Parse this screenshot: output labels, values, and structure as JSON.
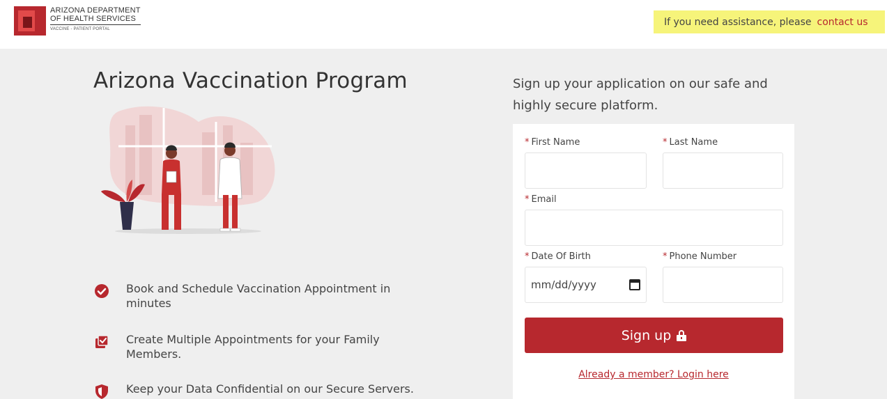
{
  "header": {
    "logo": {
      "line1": "ARIZONA DEPARTMENT",
      "line2": "OF HEALTH SERVICES",
      "sub": "VACCINE - PATIENT PORTAL"
    },
    "assist_text": "If you need assistance, please",
    "assist_link": "contact us"
  },
  "left": {
    "title": "Arizona Vaccination Program",
    "features": [
      {
        "icon": "check-circle-icon",
        "text": "Book and Schedule Vaccination Appointment in minutes"
      },
      {
        "icon": "multi-calendar-check-icon",
        "text": "Create Multiple Appointments for your Family Members."
      },
      {
        "icon": "shield-icon",
        "text": "Keep your Data Confidential on our Secure Servers."
      }
    ]
  },
  "right": {
    "tagline": "Sign up your application on our safe and highly secure platform.",
    "form": {
      "first_name": {
        "label": "First Name",
        "value": ""
      },
      "last_name": {
        "label": "Last Name",
        "value": ""
      },
      "email": {
        "label": "Email",
        "value": ""
      },
      "dob": {
        "label": "Date Of Birth",
        "value": "mm/dd/yyyy"
      },
      "phone": {
        "label": "Phone Number",
        "value": ""
      },
      "required_marker": "*",
      "submit_label": "Sign up",
      "login_link": "Already a member? Login here"
    }
  },
  "colors": {
    "brand_red": "#b7282e",
    "highlight_yellow": "#f6f47a",
    "background": "#efefef"
  }
}
